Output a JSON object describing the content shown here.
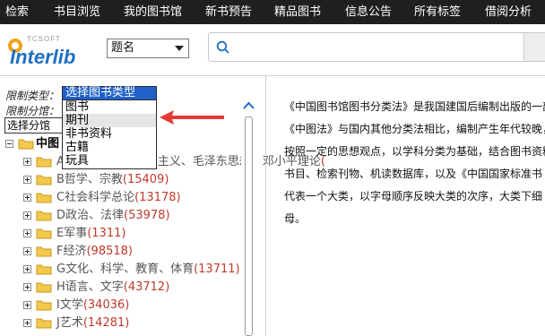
{
  "nav": {
    "items": [
      "检索",
      "书目浏览",
      "我的图书馆",
      "新书预告",
      "精品图书",
      "信息公告",
      "所有标签",
      "借阅分析"
    ]
  },
  "header": {
    "logo_small": "TCSOFT",
    "logo_text": "Interlib",
    "field_select": "题名"
  },
  "filter": {
    "type_label": "限制类型：",
    "lib_label": "限制分馆：",
    "lib_select": "选择分馆",
    "type_select": "选择图书类型",
    "type_options": [
      "图书",
      "期刊",
      "非书资料",
      "古籍",
      "玩具"
    ]
  },
  "tree": {
    "root": "中图",
    "items": [
      {
        "label": "A马克思主义、列宁主义、毛泽东思想、邓小平理论",
        "count": "("
      },
      {
        "label": "B哲学、宗教",
        "count": "(15409)"
      },
      {
        "label": "C社会科学总论",
        "count": "(13178)"
      },
      {
        "label": "D政治、法律",
        "count": "(53978)"
      },
      {
        "label": "E军事",
        "count": "(1311)"
      },
      {
        "label": "F经济",
        "count": "(98518)"
      },
      {
        "label": "G文化、科学、教育、体育",
        "count": "(13711)"
      },
      {
        "label": "H语言、文字",
        "count": "(43712)"
      },
      {
        "label": "I文学",
        "count": "(34036)"
      },
      {
        "label": "J艺术",
        "count": "(14281)"
      }
    ]
  },
  "description": {
    "lines": [
      "《中国图书馆图书分类法》是我国建国后编制出版的一部",
      "《中图法》与国内其他分类法相比，编制产生年代较晚，",
      "按照一定的思想观点，以学科分类为基础，结合图书资料",
      "书目、检索刊物、机读数据库，以及《中国国家标准书",
      "代表一个大类，以字母顺序反映大类的次序，大类下细",
      "母。"
    ]
  },
  "colors": {
    "nav_bg": "#1f1f1f",
    "selected_blue": "#2061c9",
    "count_red": "#c0392b",
    "arrow_red": "#e53935",
    "folder_yellow": "#f2c94c"
  }
}
